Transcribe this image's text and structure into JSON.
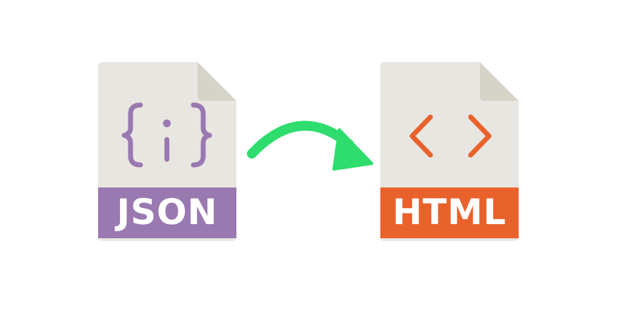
{
  "diagram": {
    "source": {
      "label": "JSON",
      "icon": "curly-braces-icon",
      "accent_color": "#9a79b1"
    },
    "target": {
      "label": "HTML",
      "icon": "angle-brackets-icon",
      "accent_color": "#e9622b"
    },
    "arrow": {
      "icon": "curved-arrow-icon",
      "color": "#2edd6e"
    },
    "sheet_color": "#e8e6e0",
    "fold_color": "#d6d3c9"
  }
}
